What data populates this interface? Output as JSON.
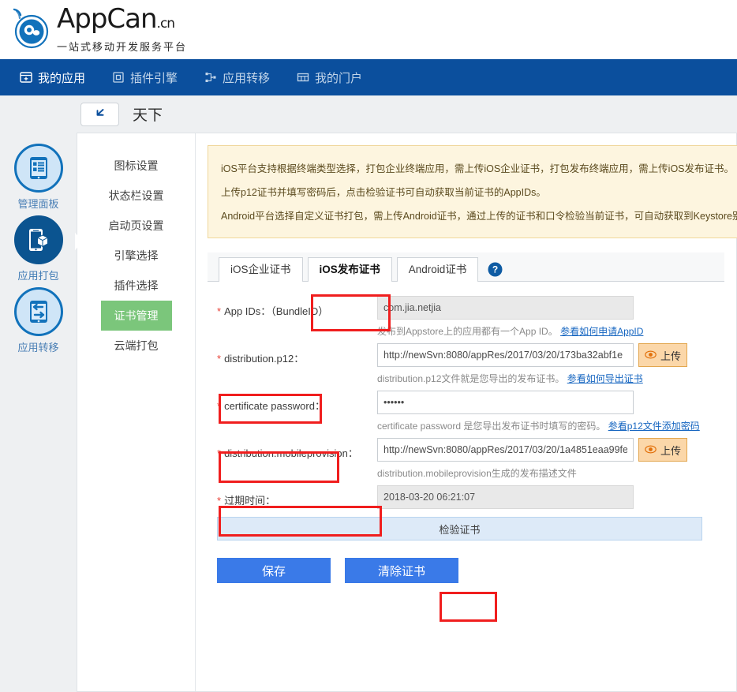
{
  "brand": {
    "name": "AppCan",
    "suffix": ".cn",
    "slogan": "一站式移动开发服务平台",
    "logo_icon": "appcan-logo-icon",
    "blue": "#1272bb"
  },
  "topnav": {
    "bg": "#0b4f9d",
    "items": [
      {
        "label": "我的应用",
        "icon": "my-apps-icon",
        "active": true
      },
      {
        "label": "插件引擎",
        "icon": "plugin-engine-icon",
        "active": false
      },
      {
        "label": "应用转移",
        "icon": "app-transfer-icon",
        "active": false
      },
      {
        "label": "我的门户",
        "icon": "my-portal-icon",
        "active": false
      }
    ]
  },
  "breadcrumb": {
    "back_icon": "back-arrow-icon",
    "title": "天下"
  },
  "rail": {
    "items": [
      {
        "label": "管理面板",
        "icon": "dashboard-icon",
        "active": false
      },
      {
        "label": "应用打包",
        "icon": "package-icon",
        "active": true
      },
      {
        "label": "应用转移",
        "icon": "transfer-icon",
        "active": false
      }
    ]
  },
  "submenu": {
    "items": [
      {
        "label": "图标设置",
        "selected": false
      },
      {
        "label": "状态栏设置",
        "selected": false
      },
      {
        "label": "启动页设置",
        "selected": false
      },
      {
        "label": "引擎选择",
        "selected": false
      },
      {
        "label": "插件选择",
        "selected": false
      },
      {
        "label": "证书管理",
        "selected": true
      },
      {
        "label": "云端打包",
        "selected": false
      }
    ],
    "selected_color": "#7bc67b"
  },
  "notice": {
    "line1": "iOS平台支持根据终端类型选择，打包企业终端应用，需上传iOS企业证书，打包发布终端应用，需上传iOS发布证书。",
    "line2": "上传p12证书并填写密码后，点击检验证书可自动获取当前证书的AppIDs。",
    "line3": "Android平台选择自定义证书打包，需上传Android证书，通过上传的证书和口令检验当前证书，可自动获取到Keystore别名"
  },
  "tabs": {
    "items": [
      {
        "label": "iOS企业证书",
        "active": false
      },
      {
        "label": "iOS发布证书",
        "active": true
      },
      {
        "label": "Android证书",
        "active": false
      }
    ],
    "help_icon": "help-question-icon"
  },
  "form": {
    "appids": {
      "label": "App IDs：（BundleID）",
      "required": true,
      "value": "com.jia.netjia",
      "placeholder": "",
      "hint_text": "发布到Appstore上的应用都有一个App ID。",
      "hint_link": "参看如何申请AppID"
    },
    "p12": {
      "label": "distribution.p12：",
      "required": true,
      "value": "http://newSvn:8080/appRes/2017/03/20/173ba32abf1e",
      "placeholder": "",
      "upload_label": "上传",
      "upload_icon": "eye-upload-icon",
      "hint_text": "distribution.p12文件就是您导出的发布证书。",
      "hint_link": "参看如何导出证书"
    },
    "password": {
      "label": "certificate password：",
      "required": true,
      "value": "••••••",
      "placeholder": "",
      "hint_text": "certificate password 是您导出发布证书时填写的密码。",
      "hint_link": "参看p12文件添加密码"
    },
    "mobileprovision": {
      "label": "distribution.mobileprovision：",
      "required": true,
      "value": "http://newSvn:8080/appRes/2017/03/20/1a4851eaa99fe",
      "placeholder": "",
      "upload_label": "上传",
      "upload_icon": "eye-upload-icon",
      "hint_text": "distribution.mobileprovision生成的发布描述文件",
      "hint_link": ""
    },
    "expiry": {
      "label": "过期时间：",
      "required": true,
      "value": "2018-03-20 06:21:07",
      "placeholder": ""
    },
    "verify_label": "检验证书",
    "save_label": "保存",
    "clear_label": "清除证书",
    "button_color": "#3a7ae8"
  },
  "annotations": {
    "highlight_color": "#f01e1e",
    "boxes": [
      "tab-ios-publish-cert",
      "label-distribution-p12",
      "label-certificate-password",
      "label-distribution-mobileprovision",
      "verify-certificate-button"
    ]
  }
}
